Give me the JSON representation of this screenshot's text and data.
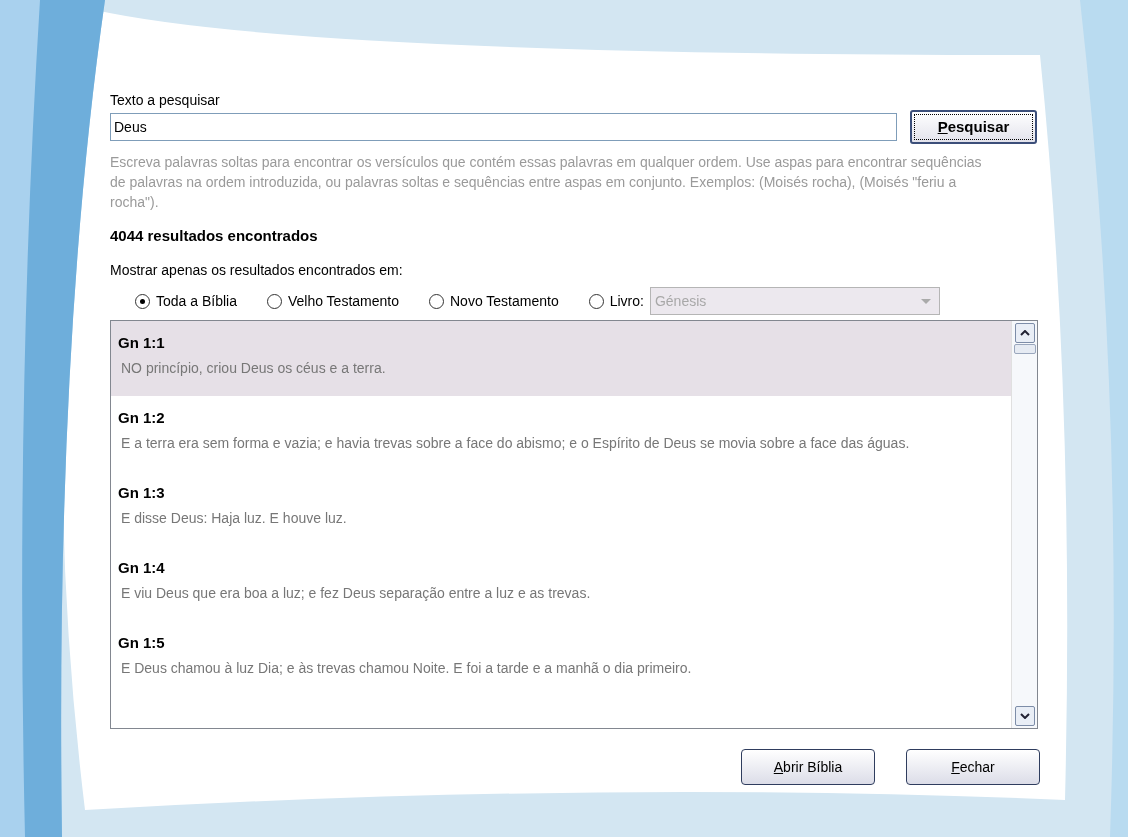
{
  "search": {
    "label": "Texto a pesquisar",
    "value": "Deus",
    "button": {
      "label": "Pesquisar"
    }
  },
  "help": "Escreva palavras soltas para encontrar os versículos que contém essas palavras em qualquer ordem. Use aspas para encontrar sequências de palavras na ordem introduzida, ou palavras soltas e sequências entre aspas em conjunto. Exemplos: (Moisés rocha), (Moisés \"feriu a rocha\").",
  "results_count": "4044 resultados encontrados",
  "filter": {
    "label": "Mostrar apenas os resultados encontrados em:",
    "options": [
      {
        "kind": "radio",
        "label": "Toda a Bíblia",
        "selected": true
      },
      {
        "kind": "radio",
        "label": "Velho Testamento",
        "selected": false
      },
      {
        "kind": "radio",
        "label": "Novo Testamento",
        "selected": false
      },
      {
        "kind": "book",
        "label": "Livro:",
        "selected": false,
        "dropdown": {
          "value": "Génesis",
          "disabled": true
        }
      }
    ]
  },
  "results": [
    {
      "ref": "Gn 1:1",
      "text": "NO princípio, criou Deus os céus e a terra.",
      "selected": true
    },
    {
      "ref": "Gn 1:2",
      "text": "E a terra era sem forma e vazia; e havia trevas sobre a face do abismo; e o Espírito de Deus se movia sobre a face das águas.",
      "selected": false
    },
    {
      "ref": "Gn 1:3",
      "text": "E disse Deus: Haja luz. E houve luz.",
      "selected": false
    },
    {
      "ref": "Gn 1:4",
      "text": "E viu Deus que era boa a luz; e fez Deus separação entre a luz e as trevas.",
      "selected": false
    },
    {
      "ref": "Gn 1:5",
      "text": "E Deus chamou à luz Dia; e às trevas chamou Noite. E foi a tarde e a manhã o dia primeiro.",
      "selected": false
    }
  ],
  "buttons": [
    {
      "label": "Abrir Bíblia"
    },
    {
      "label": "Fechar"
    }
  ]
}
